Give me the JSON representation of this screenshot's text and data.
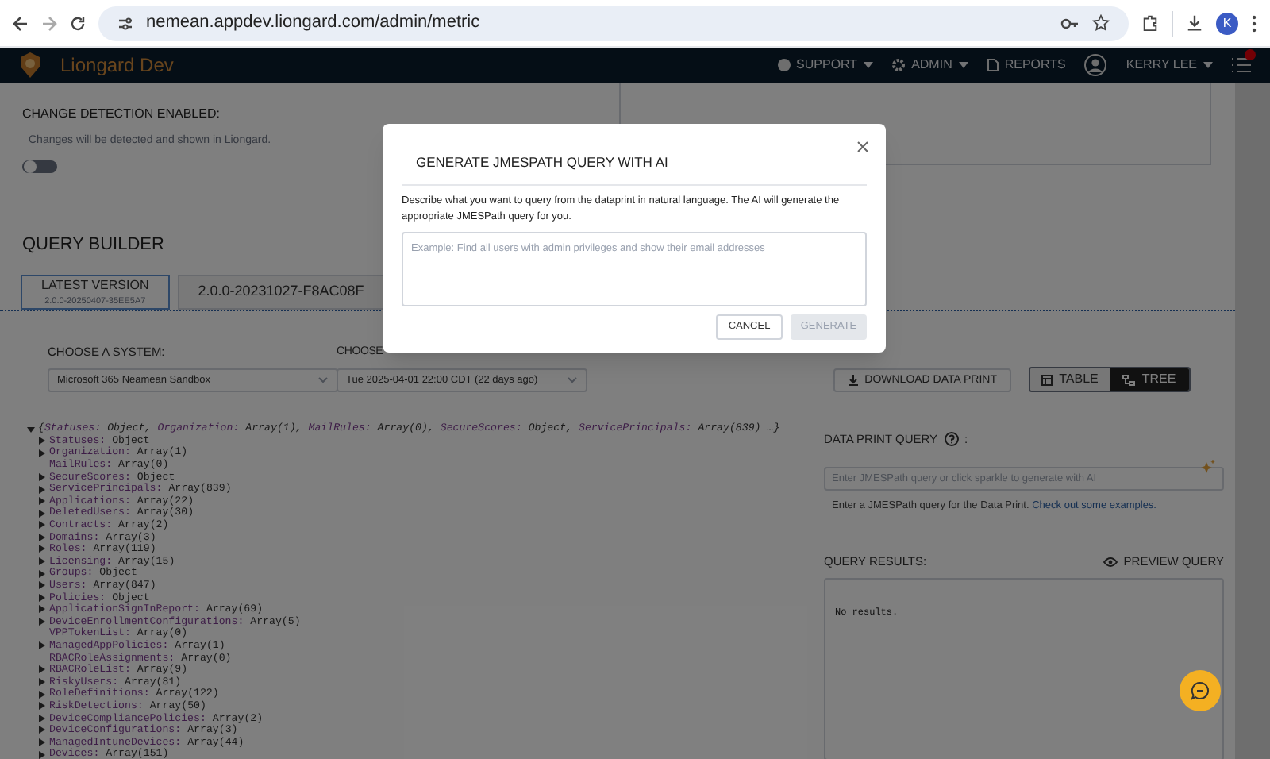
{
  "browser": {
    "url": "nemean.appdev.liongard.com/admin/metric",
    "profile_initial": "K"
  },
  "nav": {
    "brand": "Liongard Dev",
    "items": [
      {
        "label": "SUPPORT",
        "kind": "dropdown"
      },
      {
        "label": "ADMIN",
        "kind": "dropdown"
      },
      {
        "label": "REPORTS",
        "kind": "link"
      }
    ],
    "user": "KERRY LEE"
  },
  "change_detection": {
    "label": "CHANGE DETECTION ENABLED:",
    "help": "Changes will be detected and shown in Liongard.",
    "on": false
  },
  "query_builder": {
    "title": "QUERY BUILDER",
    "tabs": [
      {
        "label": "LATEST VERSION",
        "sublabel": "2.0.0-20250407-35EE5A7",
        "selected": true
      },
      {
        "label": "2.0.0-20231027-F8AC08F",
        "selected": false
      }
    ]
  },
  "system": {
    "label": "CHOOSE A SYSTEM:",
    "value": "Microsoft 365 Neamean Sandbox"
  },
  "snapshot": {
    "label": "CHOOSE",
    "value": "Tue 2025-04-01 22:00 CDT (22 days ago)"
  },
  "download_button": "DOWNLOAD DATA PRINT",
  "view_toggle": [
    {
      "label": "TABLE",
      "selected": false
    },
    {
      "label": "TREE",
      "selected": true
    }
  ],
  "tree": {
    "expanded": true,
    "open": "{",
    "close": "…}",
    "summary": [
      {
        "key": "Statuses:",
        "value": "Object,"
      },
      {
        "key": "Organization:",
        "value": "Array(1),"
      },
      {
        "key": "MailRules:",
        "value": "Array(0),"
      },
      {
        "key": "SecureScores:",
        "value": "Object,"
      },
      {
        "key": "ServicePrincipals:",
        "value": "Array(839)"
      }
    ],
    "children": [
      {
        "key": "Statuses:",
        "value": "Object",
        "expandable": true
      },
      {
        "key": "Organization:",
        "value": "Array(1)",
        "expandable": true
      },
      {
        "key": "MailRules:",
        "value": "Array(0)",
        "expandable": false
      },
      {
        "key": "SecureScores:",
        "value": "Object",
        "expandable": true
      },
      {
        "key": "ServicePrincipals:",
        "value": "Array(839)",
        "expandable": true
      },
      {
        "key": "Applications:",
        "value": "Array(22)",
        "expandable": true
      },
      {
        "key": "DeletedUsers:",
        "value": "Array(30)",
        "expandable": true
      },
      {
        "key": "Contracts:",
        "value": "Array(2)",
        "expandable": true
      },
      {
        "key": "Domains:",
        "value": "Array(3)",
        "expandable": true
      },
      {
        "key": "Roles:",
        "value": "Array(119)",
        "expandable": true
      },
      {
        "key": "Licensing:",
        "value": "Array(15)",
        "expandable": true
      },
      {
        "key": "Groups:",
        "value": "Object",
        "expandable": true
      },
      {
        "key": "Users:",
        "value": "Array(847)",
        "expandable": true
      },
      {
        "key": "Policies:",
        "value": "Object",
        "expandable": true
      },
      {
        "key": "ApplicationSignInReport:",
        "value": "Array(69)",
        "expandable": true
      },
      {
        "key": "DeviceEnrollmentConfigurations:",
        "value": "Array(5)",
        "expandable": true
      },
      {
        "key": "VPPTokenList:",
        "value": "Array(0)",
        "expandable": false
      },
      {
        "key": "ManagedAppPolicies:",
        "value": "Array(1)",
        "expandable": true
      },
      {
        "key": "RBACRoleAssignments:",
        "value": "Array(0)",
        "expandable": false
      },
      {
        "key": "RBACRoleList:",
        "value": "Array(9)",
        "expandable": true
      },
      {
        "key": "RiskyUsers:",
        "value": "Array(81)",
        "expandable": true
      },
      {
        "key": "RoleDefinitions:",
        "value": "Array(122)",
        "expandable": true
      },
      {
        "key": "RiskDetections:",
        "value": "Array(50)",
        "expandable": true
      },
      {
        "key": "DeviceCompliancePolicies:",
        "value": "Array(2)",
        "expandable": true
      },
      {
        "key": "DeviceConfigurations:",
        "value": "Array(3)",
        "expandable": true
      },
      {
        "key": "ManagedIntuneDevices:",
        "value": "Array(44)",
        "expandable": true
      },
      {
        "key": "Devices:",
        "value": "Array(151)",
        "expandable": true
      }
    ]
  },
  "data_print_query": {
    "label": "DATA PRINT QUERY",
    "suffix": ":",
    "placeholder": "Enter JMESPath query or click sparkle to generate with AI",
    "help": "Enter a JMESPath query for the Data Print.",
    "help_link": "Check out some examples."
  },
  "query_results": {
    "label": "QUERY RESULTS:",
    "preview_button": "PREVIEW QUERY",
    "output": "No results."
  },
  "modal": {
    "title": "GENERATE JMESPATH QUERY WITH AI",
    "description": "Describe what you want to query from the dataprint in natural language. The AI will generate the appropriate JMESPath query for you.",
    "placeholder": "Example: Find all users with admin privileges and show their email addresses",
    "buttons": [
      {
        "label": "CANCEL",
        "disabled": false
      },
      {
        "label": "GENERATE",
        "disabled": true
      }
    ]
  }
}
